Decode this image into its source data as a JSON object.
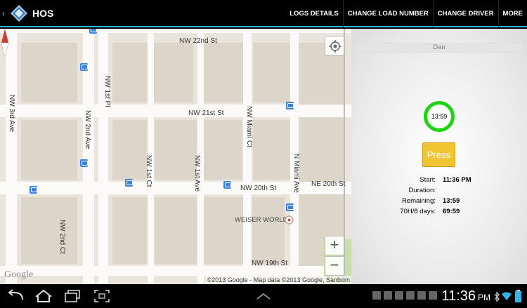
{
  "actionbar": {
    "title": "HOS",
    "actions": [
      {
        "label": "LOGS DETAILS"
      },
      {
        "label": "CHANGE LOAD NUMBER"
      },
      {
        "label": "CHANGE DRIVER"
      },
      {
        "label": "MORE"
      }
    ]
  },
  "map": {
    "streets": {
      "nw22": "NW 22nd St",
      "nw21": "NW 21st St",
      "nw20": "NW 20th St",
      "ne20": "NE 20th St",
      "nw19": "NW 19th St",
      "nw3ave": "NW 3rd Ave",
      "nw2ave": "NW 2nd Ave",
      "nw1pl": "NW 1st Pl",
      "nw1ct": "NW 1st Ct",
      "nw1ave": "NW 1st Ave",
      "nwmiamict": "NW Miami Ct",
      "nmiamiave": "N Miami Ave",
      "nw2ct": "NW 2nd Ct"
    },
    "poi": "WEISER WORLD",
    "zoom_in": "+",
    "zoom_out": "−",
    "logo": "Google",
    "copyright": "©2013 Google - Map data ©2013 Google, Sanborn"
  },
  "panel": {
    "driver": "Dan",
    "timer": "13:59",
    "press_label": "Press",
    "stats": [
      {
        "label": "Start:",
        "value": "11:36 PM"
      },
      {
        "label": "Duration:",
        "value": ""
      },
      {
        "label": "Remaining:",
        "value": "13:59"
      },
      {
        "label": "70H/8 days:",
        "value": "69:59"
      }
    ]
  },
  "sysbar": {
    "clock": "11:36",
    "ampm": "PM"
  },
  "colors": {
    "accent": "#33b5e5",
    "timer_ring": "#1ed30f",
    "press_button": "#f1c531",
    "bus_stop": "#3b82d8"
  }
}
